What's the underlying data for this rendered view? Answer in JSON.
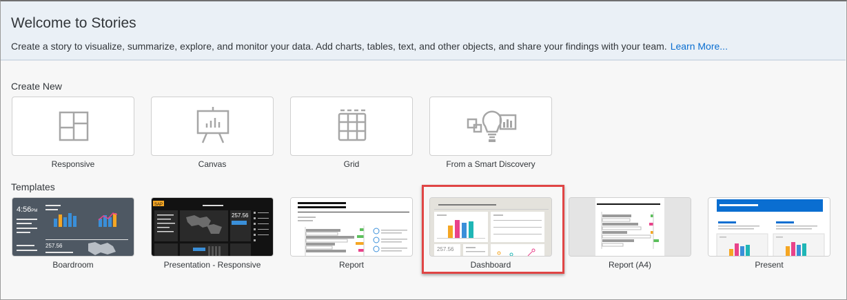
{
  "header": {
    "title": "Welcome to Stories",
    "description": "Create a story to visualize, summarize, explore, and monitor your data. Add charts, tables, text, and other objects, and share your findings with your team.",
    "learn_more": "Learn More..."
  },
  "create_new": {
    "label": "Create New",
    "items": [
      {
        "label": "Responsive",
        "icon": "responsive-layout-icon"
      },
      {
        "label": "Canvas",
        "icon": "canvas-easel-icon"
      },
      {
        "label": "Grid",
        "icon": "grid-table-icon"
      },
      {
        "label": "From a Smart Discovery",
        "icon": "smart-discovery-lightbulb-icon"
      }
    ]
  },
  "templates": {
    "label": "Templates",
    "items": [
      {
        "label": "Boardroom",
        "thumb_time": "4:56",
        "thumb_time_suffix": "PM",
        "thumb_value": "257.56"
      },
      {
        "label": "Presentation - Responsive",
        "thumb_brand": "SAP",
        "thumb_value": "257.56"
      },
      {
        "label": "Report"
      },
      {
        "label": "Dashboard",
        "thumb_value": "257.56",
        "selected": true
      },
      {
        "label": "Report (A4)"
      },
      {
        "label": "Present"
      }
    ]
  },
  "colors": {
    "accent": "#0a6ed1",
    "highlight": "#e04545",
    "icon_gray": "#a6a6a6",
    "chart_blue": "#3a8fd9",
    "chart_orange": "#f5a623",
    "chart_pink": "#e9428a",
    "chart_teal": "#1fb6b6",
    "chart_green": "#5cc05c"
  }
}
